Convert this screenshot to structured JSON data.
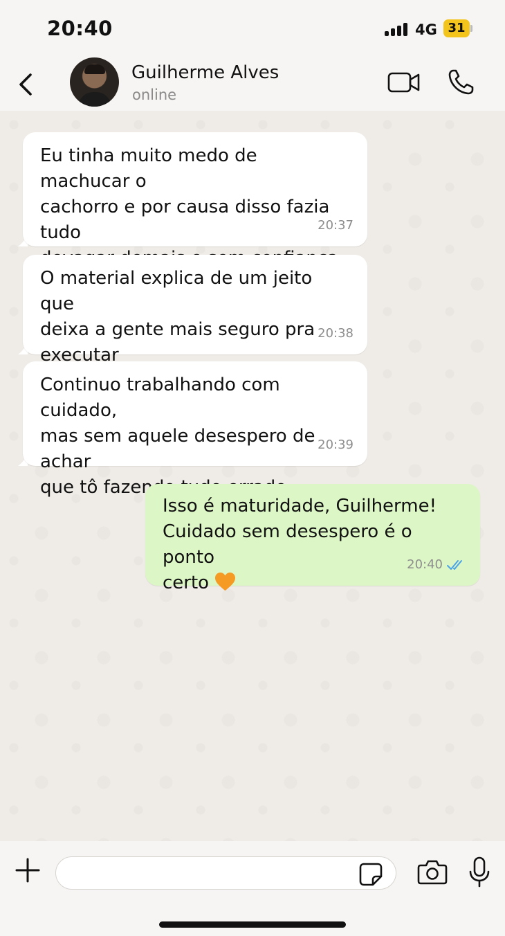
{
  "status_bar": {
    "time": "20:40",
    "network": "4G",
    "battery": "31"
  },
  "header": {
    "contact_name": "Guilherme Alves",
    "contact_status": "online"
  },
  "messages": [
    {
      "direction": "incoming",
      "text": "Eu tinha muito medo de machucar o\ncachorro e por causa disso fazia tudo\ndevagar demais e sem confiança",
      "time": "20:37"
    },
    {
      "direction": "incoming",
      "text": "O material explica de um jeito que\ndeixa a gente mais seguro pra\nexecutar",
      "time": "20:38"
    },
    {
      "direction": "incoming",
      "text": "Continuo trabalhando com cuidado,\nmas sem aquele desespero de achar\nque tô fazendo tudo errado",
      "time": "20:39"
    },
    {
      "direction": "outgoing",
      "text": "Isso é maturidade, Guilherme!\nCuidado sem desespero é o ponto\ncerto",
      "emoji": "orange-heart",
      "time": "20:40",
      "read_receipt": "double-check-blue"
    }
  ],
  "input": {
    "value": "",
    "placeholder": ""
  },
  "colors": {
    "outgoing_bubble": "#dcf7c5",
    "incoming_bubble": "#ffffff",
    "battery": "#f3c51c",
    "read_check": "#4aa3e8",
    "heart": "#f59a23"
  },
  "icons": [
    "back-icon",
    "video-call-icon",
    "voice-call-icon",
    "plus-icon",
    "sticker-icon",
    "camera-icon",
    "microphone-icon"
  ]
}
